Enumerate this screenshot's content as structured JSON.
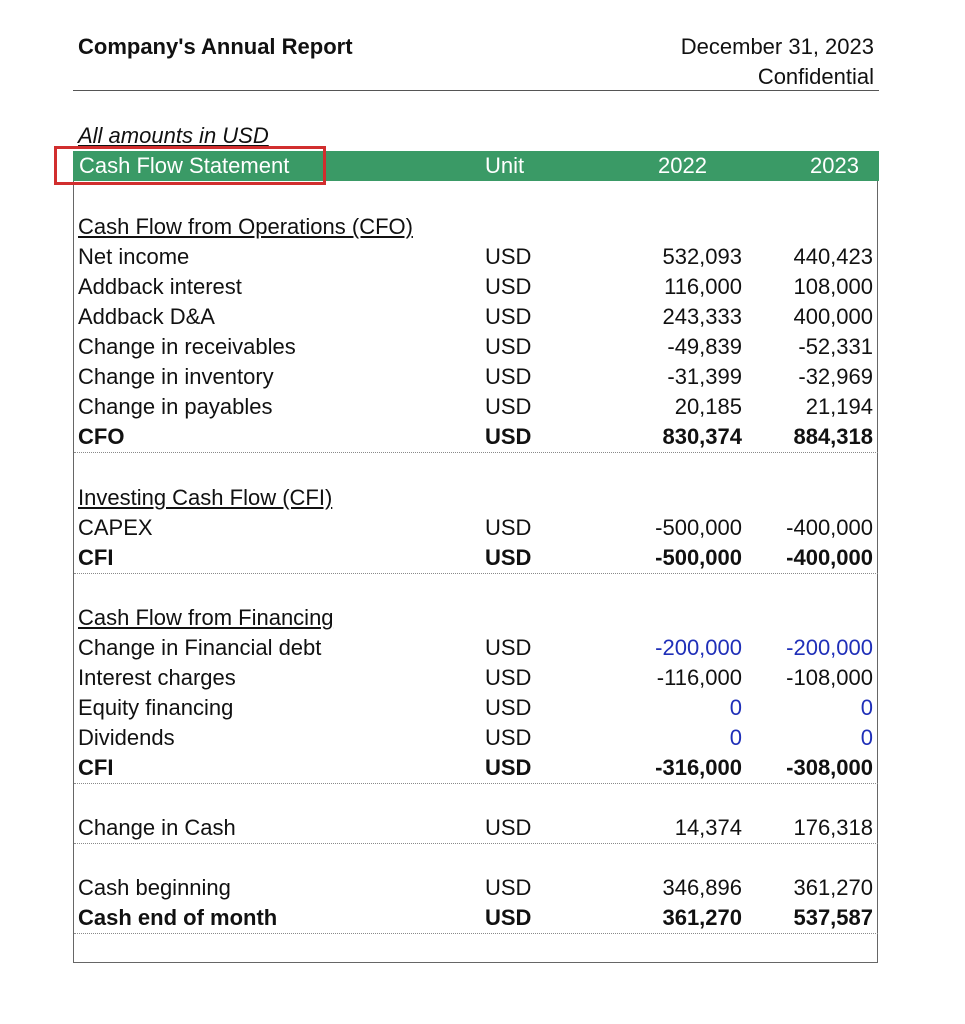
{
  "header": {
    "title": "Company's Annual Report",
    "date": "December 31, 2023",
    "confidential": "Confidential",
    "amounts_note": "All amounts in USD"
  },
  "table_header": {
    "label": "Cash Flow Statement",
    "unit": "Unit",
    "year1": "2022",
    "year2": "2023"
  },
  "colors": {
    "header_band": "#3a9a66",
    "highlight_box": "#d12e2e",
    "input_value": "#1f2fb8"
  },
  "sections": {
    "cfo": {
      "title": "Cash Flow from Operations (CFO)"
    },
    "cfi": {
      "title": "Investing Cash Flow (CFI)"
    },
    "cff": {
      "title": "Cash Flow from Financing"
    }
  },
  "rows": {
    "net_income": {
      "label": "Net income",
      "unit": "USD",
      "y2022": "532,093",
      "y2023": "440,423"
    },
    "addback_interest": {
      "label": "Addback interest",
      "unit": "USD",
      "y2022": "116,000",
      "y2023": "108,000"
    },
    "addback_da": {
      "label": "Addback D&A",
      "unit": "USD",
      "y2022": "243,333",
      "y2023": "400,000"
    },
    "change_receivables": {
      "label": "Change in receivables",
      "unit": "USD",
      "y2022": "-49,839",
      "y2023": "-52,331"
    },
    "change_inventory": {
      "label": "Change in inventory",
      "unit": "USD",
      "y2022": "-31,399",
      "y2023": "-32,969"
    },
    "change_payables": {
      "label": "Change in payables",
      "unit": "USD",
      "y2022": "20,185",
      "y2023": "21,194"
    },
    "cfo_total": {
      "label": "CFO",
      "unit": "USD",
      "y2022": "830,374",
      "y2023": "884,318"
    },
    "capex": {
      "label": "CAPEX",
      "unit": "USD",
      "y2022": "-500,000",
      "y2023": "-400,000"
    },
    "cfi_total": {
      "label": "CFI",
      "unit": "USD",
      "y2022": "-500,000",
      "y2023": "-400,000"
    },
    "change_fin_debt": {
      "label": "Change in Financial debt",
      "unit": "USD",
      "y2022": "-200,000",
      "y2023": "-200,000"
    },
    "interest_charges": {
      "label": "Interest charges",
      "unit": "USD",
      "y2022": "-116,000",
      "y2023": "-108,000"
    },
    "equity_financing": {
      "label": "Equity financing",
      "unit": "USD",
      "y2022": "0",
      "y2023": "0"
    },
    "dividends": {
      "label": "Dividends",
      "unit": "USD",
      "y2022": "0",
      "y2023": "0"
    },
    "cff_total": {
      "label": "CFI",
      "unit": "USD",
      "y2022": "-316,000",
      "y2023": "-308,000"
    },
    "change_cash": {
      "label": "Change in Cash",
      "unit": "USD",
      "y2022": "14,374",
      "y2023": "176,318"
    },
    "cash_beginning": {
      "label": "Cash beginning",
      "unit": "USD",
      "y2022": "346,896",
      "y2023": "361,270"
    },
    "cash_end": {
      "label": "Cash end of month",
      "unit": "USD",
      "y2022": "361,270",
      "y2023": "537,587"
    }
  }
}
